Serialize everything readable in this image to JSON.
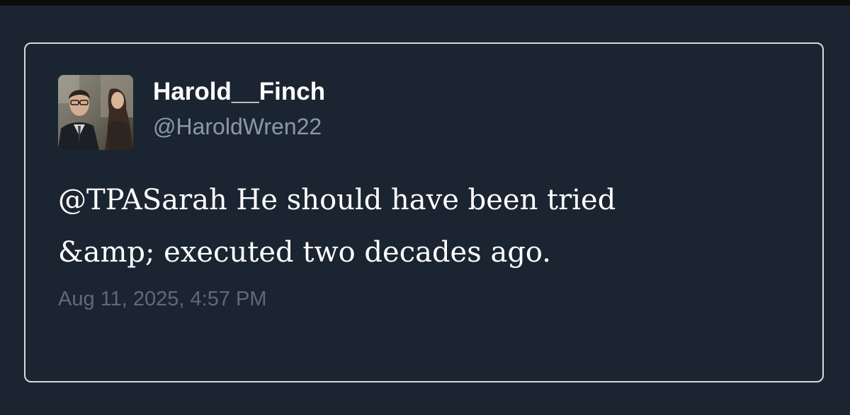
{
  "tweet": {
    "display_name": "Harold__Finch",
    "handle": "@HaroldWren22",
    "text_lines": [
      "@TPASarah He should have been tried",
      "&amp; executed two decades ago."
    ],
    "timestamp": "Aug 11, 2025, 4:57 PM",
    "avatar_icon": "profile-photo-two-people"
  },
  "colors": {
    "background": "#1b2532",
    "card_border": "#d6dadf",
    "name": "#ffffff",
    "handle": "#8d98a5",
    "timestamp": "#5f6a76"
  }
}
